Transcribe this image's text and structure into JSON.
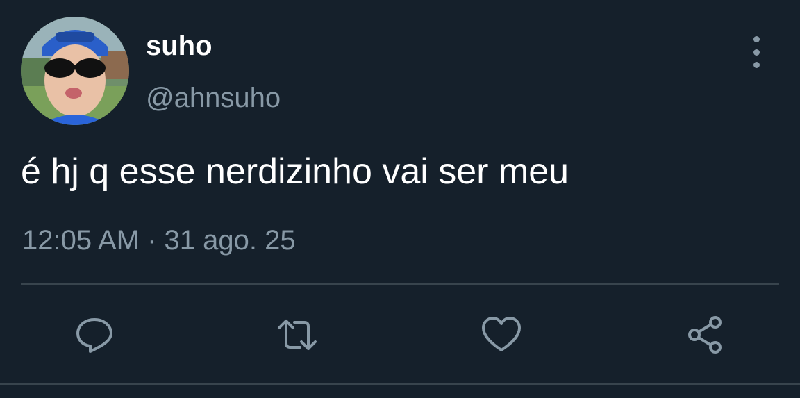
{
  "tweet": {
    "display_name": "suho",
    "handle": "@ahnsuho",
    "text": "é hj q esse nerdizinho vai ser meu",
    "timestamp": "12:05 AM · 31 ago. 25"
  },
  "icons": {
    "more": "more-vertical-icon",
    "reply": "reply-icon",
    "retweet": "retweet-icon",
    "like": "heart-icon",
    "share": "share-icon"
  },
  "colors": {
    "background": "#15202b",
    "primary_text": "#ffffff",
    "secondary_text": "#8899a6",
    "divider": "#38444d"
  }
}
